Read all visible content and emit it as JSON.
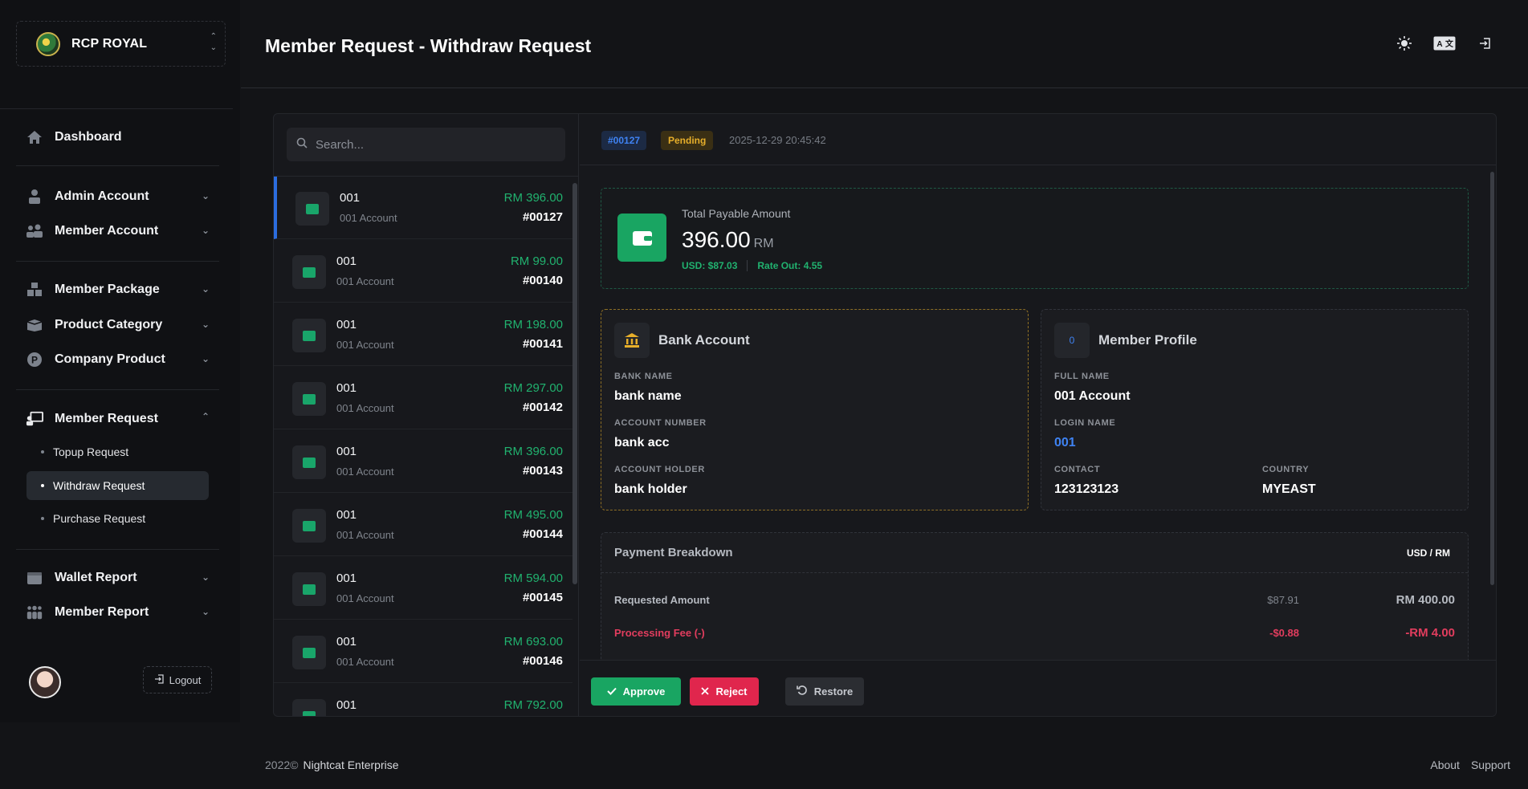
{
  "brand": {
    "name": "RCP ROYAL"
  },
  "sidebar": {
    "items": [
      {
        "label": "Dashboard"
      },
      {
        "label": "Admin Account"
      },
      {
        "label": "Member Account"
      },
      {
        "label": "Member Package"
      },
      {
        "label": "Product Category"
      },
      {
        "label": "Company Product"
      },
      {
        "label": "Member Request"
      },
      {
        "label": "Wallet Report"
      },
      {
        "label": "Member Report"
      }
    ],
    "sub_items": [
      {
        "label": "Topup Request"
      },
      {
        "label": "Withdraw Request"
      },
      {
        "label": "Purchase Request"
      }
    ],
    "logout_label": "Logout"
  },
  "header": {
    "title": "Member Request - Withdraw Request"
  },
  "search": {
    "placeholder": "Search..."
  },
  "requests": [
    {
      "name": "001",
      "account": "001 Account",
      "amount": "RM 396.00",
      "id": "#00127"
    },
    {
      "name": "001",
      "account": "001 Account",
      "amount": "RM 99.00",
      "id": "#00140"
    },
    {
      "name": "001",
      "account": "001 Account",
      "amount": "RM 198.00",
      "id": "#00141"
    },
    {
      "name": "001",
      "account": "001 Account",
      "amount": "RM 297.00",
      "id": "#00142"
    },
    {
      "name": "001",
      "account": "001 Account",
      "amount": "RM 396.00",
      "id": "#00143"
    },
    {
      "name": "001",
      "account": "001 Account",
      "amount": "RM 495.00",
      "id": "#00144"
    },
    {
      "name": "001",
      "account": "001 Account",
      "amount": "RM 594.00",
      "id": "#00145"
    },
    {
      "name": "001",
      "account": "001 Account",
      "amount": "RM 693.00",
      "id": "#00146"
    },
    {
      "name": "001",
      "account": "",
      "amount": "RM 792.00",
      "id": ""
    }
  ],
  "detail": {
    "id": "#00127",
    "status": "Pending",
    "datetime": "2025-12-29 20:45:42",
    "payable": {
      "label": "Total Payable Amount",
      "amount": "396.00",
      "currency": "RM",
      "usd": "USD: $87.03",
      "rate": "Rate Out: 4.55"
    },
    "bank": {
      "title": "Bank Account",
      "bank_name_label": "BANK NAME",
      "bank_name": "bank name",
      "account_number_label": "ACCOUNT NUMBER",
      "account_number": "bank acc",
      "account_holder_label": "ACCOUNT HOLDER",
      "account_holder": "bank holder"
    },
    "member": {
      "title": "Member Profile",
      "avatar_initial": "0",
      "full_name_label": "FULL NAME",
      "full_name": "001 Account",
      "login_name_label": "LOGIN NAME",
      "login_name": "001",
      "contact_label": "CONTACT",
      "contact": "123123123",
      "country_label": "COUNTRY",
      "country": "MYEAST"
    },
    "breakdown": {
      "title": "Payment Breakdown",
      "unit": "USD / RM",
      "rows": [
        {
          "label": "Requested Amount",
          "usd": "$87.91",
          "rm": "RM 400.00"
        },
        {
          "label": "Processing Fee (-)",
          "usd": "-$0.88",
          "rm": "-RM 4.00"
        }
      ]
    },
    "actions": {
      "approve": "Approve",
      "reject": "Reject",
      "restore": "Restore"
    }
  },
  "footer": {
    "year": "2022©",
    "company": "Nightcat Enterprise",
    "about": "About",
    "support": "Support"
  },
  "colors": {
    "accent_green": "#19a562",
    "accent_red": "#e0264d",
    "accent_blue": "#3f83f3",
    "pending": "#e6ae2a"
  }
}
